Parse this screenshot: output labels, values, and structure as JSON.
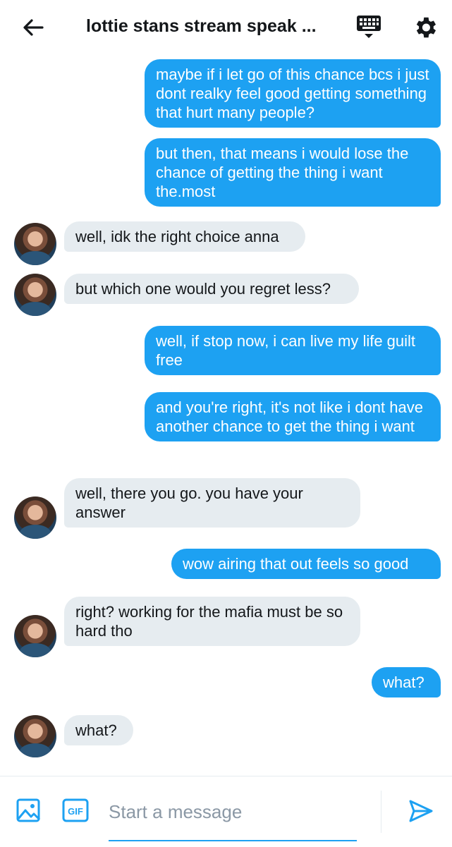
{
  "header": {
    "title": "lottie stans stream speak ...",
    "icons": [
      "back-arrow-icon",
      "keyboard-icon",
      "gear-icon"
    ]
  },
  "messages": [
    {
      "side": "out",
      "text": "maybe if i let go of this chance bcs i just dont realky feel good getting something that hurt many people?"
    },
    {
      "side": "out",
      "text": "but then, that means i would lose the chance of getting the thing i want the.most"
    },
    {
      "side": "in",
      "text": "well, idk the right choice anna"
    },
    {
      "side": "in",
      "text": "but which one would you regret less?"
    },
    {
      "side": "out",
      "text": "well, if stop now, i can live my life guilt free"
    },
    {
      "side": "out",
      "text": "and you're right, it's not like i dont have another chance to get the thing i want"
    },
    {
      "side": "in",
      "text": "well, there you go. you have your answer"
    },
    {
      "side": "out",
      "text": "wow airing that out feels so good"
    },
    {
      "side": "in",
      "text": "right? working for the mafia must be so hard tho"
    },
    {
      "side": "out",
      "text": "what?"
    },
    {
      "side": "in",
      "text": "what?"
    }
  ],
  "composer": {
    "placeholder": "Start a message",
    "value": "",
    "gif_label": "GIF",
    "icons": [
      "image-icon",
      "gif-icon",
      "send-icon"
    ]
  },
  "colors": {
    "accent": "#1da1f2",
    "incoming_bubble": "#e6ecf0",
    "text": "#14171a"
  }
}
